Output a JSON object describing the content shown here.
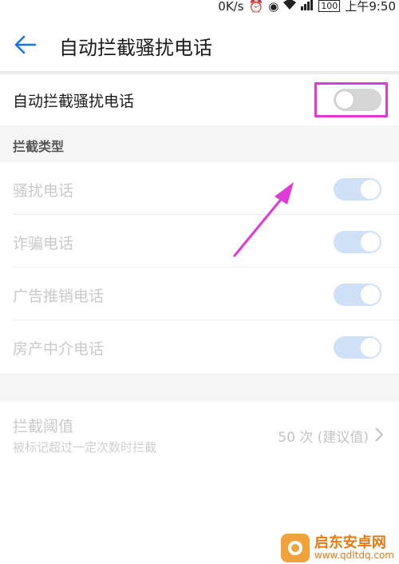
{
  "status_bar": {
    "speed": "0K/s",
    "battery": "100",
    "time": "上午9:50"
  },
  "app_bar": {
    "title": "自动拦截骚扰电话"
  },
  "main_setting": {
    "label": "自动拦截骚扰电话",
    "enabled": false
  },
  "section": {
    "title": "拦截类型"
  },
  "types": [
    {
      "label": "骚扰电话",
      "enabled": true
    },
    {
      "label": "诈骗电话",
      "enabled": true
    },
    {
      "label": "广告推销电话",
      "enabled": true
    },
    {
      "label": "房产中介电话",
      "enabled": true
    }
  ],
  "threshold": {
    "label": "拦截阈值",
    "description": "被标记超过一定次数时拦截",
    "value": "50 次 (建议值)"
  },
  "watermark": {
    "name": "启东安卓网",
    "url": "www.qdltdq.com"
  },
  "colors": {
    "accent": "#1a73e8",
    "highlight": "#e03ad6",
    "toggle_on_disabled": "#cfe0f7",
    "toggle_off": "#d6d6d6"
  }
}
